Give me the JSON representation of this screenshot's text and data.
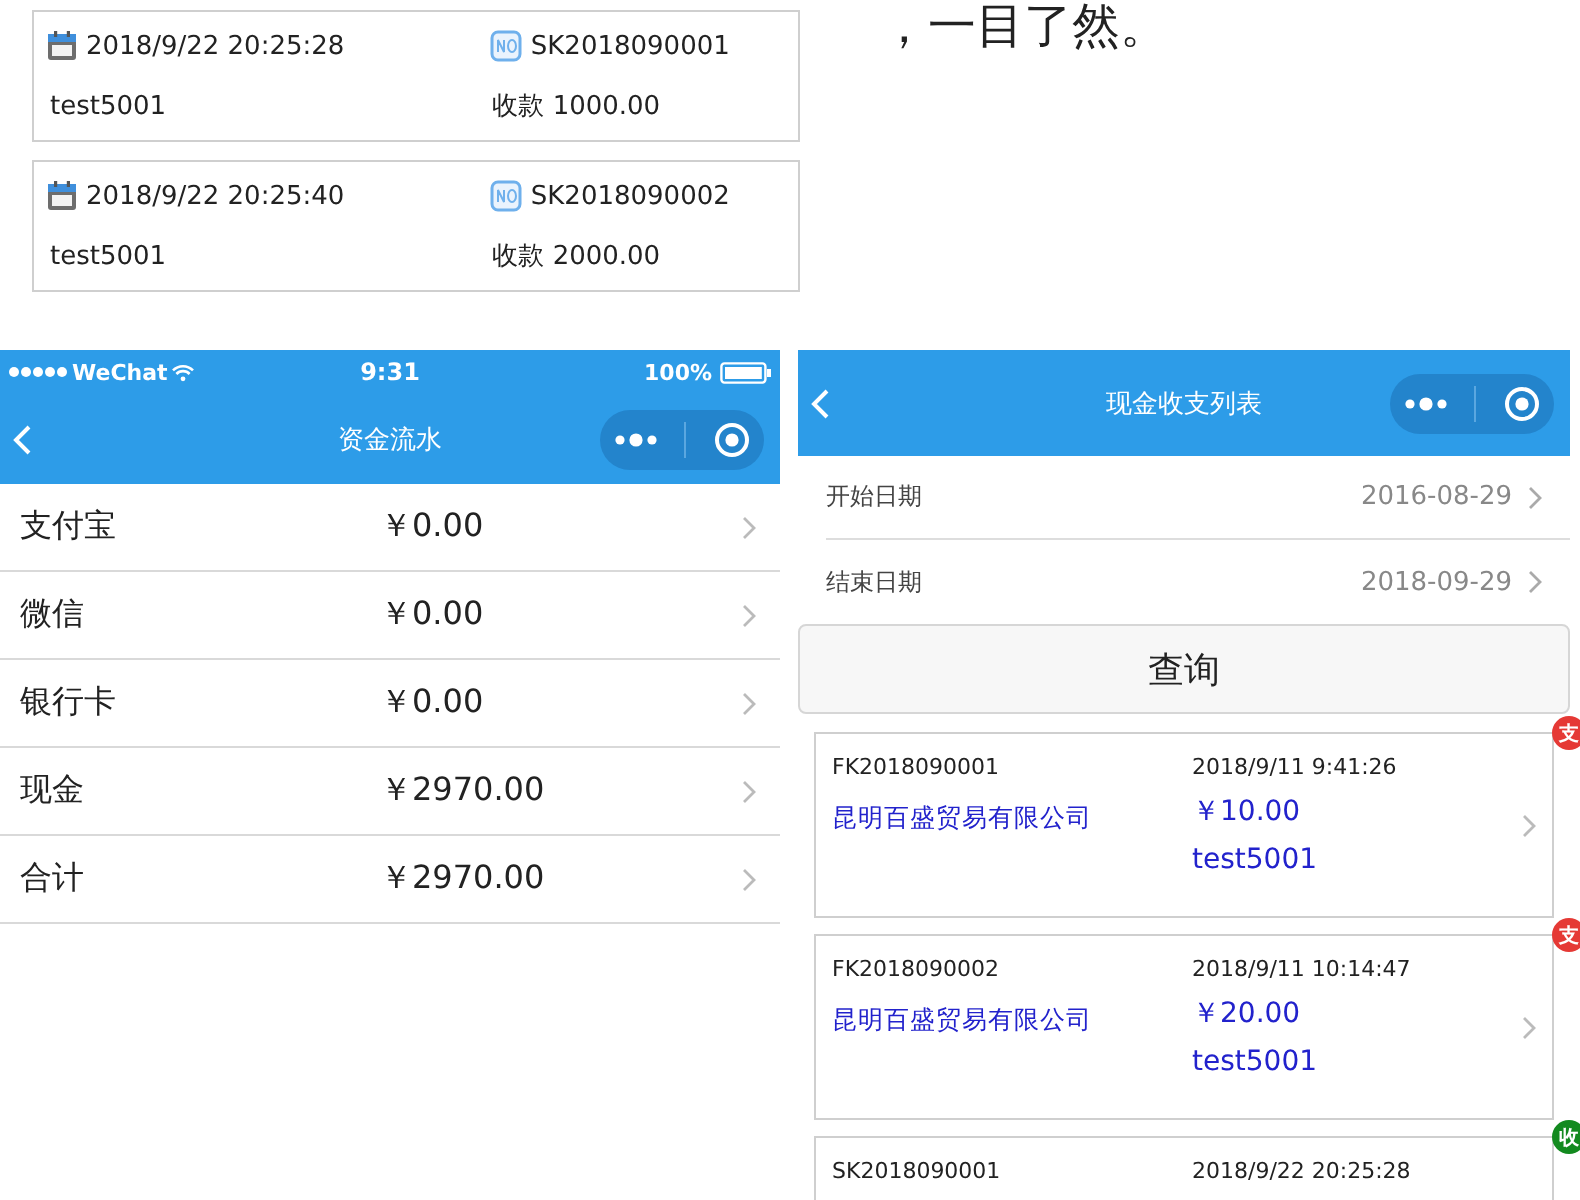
{
  "caption": "，一目了然。",
  "receipts": [
    {
      "date": "2018/9/22 20:25:28",
      "number": "SK2018090001",
      "user": "test5001",
      "amount": "收款 1000.00"
    },
    {
      "date": "2018/9/22 20:25:40",
      "number": "SK2018090002",
      "user": "test5001",
      "amount": "收款 2000.00"
    }
  ],
  "fund_flow": {
    "status_bar": {
      "carrier": "WeChat",
      "time": "9:31",
      "battery": "100%"
    },
    "title": "资金流水",
    "rows": [
      {
        "label": "支付宝",
        "amount": "￥0.00"
      },
      {
        "label": "微信",
        "amount": "￥0.00"
      },
      {
        "label": "银行卡",
        "amount": "￥0.00"
      },
      {
        "label": "现金",
        "amount": "￥2970.00"
      },
      {
        "label": "合计",
        "amount": "￥2970.00"
      }
    ]
  },
  "cash_list": {
    "title": "现金收支列表",
    "filters": [
      {
        "label": "开始日期",
        "value": "2016-08-29"
      },
      {
        "label": "结束日期",
        "value": "2018-09-29"
      }
    ],
    "query_button": "查询",
    "entries": [
      {
        "color": "#e53935",
        "tag": "支",
        "number": "FK2018090001",
        "date": "2018/9/11 9:41:26",
        "company": "昆明百盛贸易有限公司",
        "amount": "￥10.00",
        "user": "test5001"
      },
      {
        "color": "#e53935",
        "tag": "支",
        "number": "FK2018090002",
        "date": "2018/9/11 10:14:47",
        "company": "昆明百盛贸易有限公司",
        "amount": "￥20.00",
        "user": "test5001"
      },
      {
        "color": "#138a1f",
        "tag": "收",
        "number": "SK2018090001",
        "date": "2018/9/22 20:25:28"
      }
    ]
  }
}
